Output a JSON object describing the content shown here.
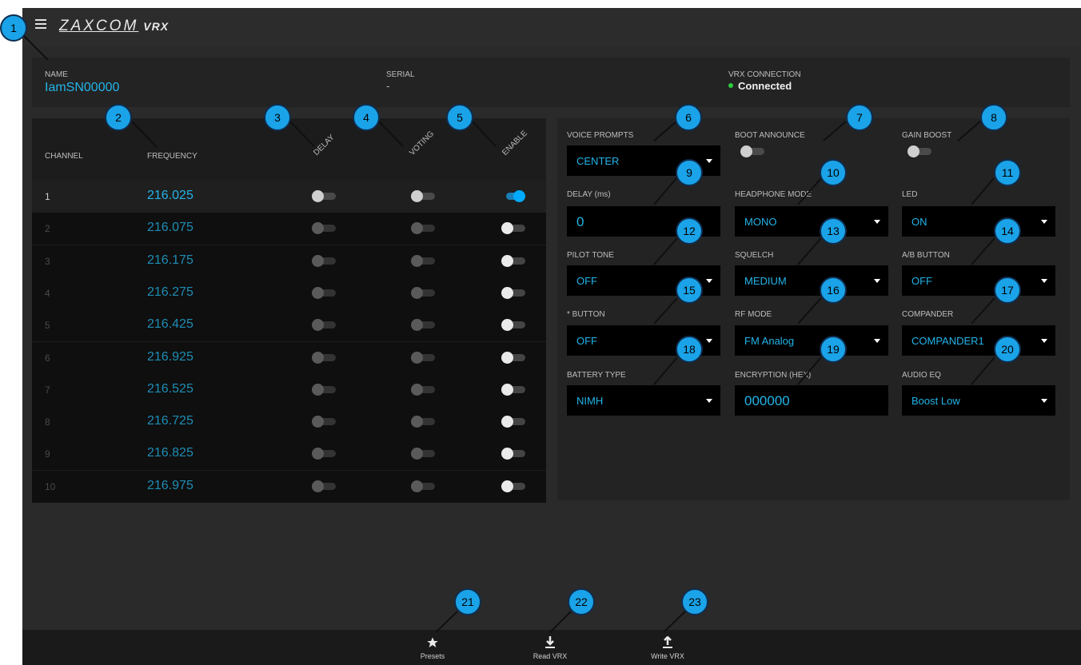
{
  "app": {
    "brand": "ZAXCOM",
    "model": "VRX"
  },
  "info": {
    "name_label": "NAME",
    "name_value": "IamSN00000",
    "serial_label": "SERIAL",
    "serial_value": "-",
    "connection_label": "VRX CONNECTION",
    "connection_value": "Connected",
    "connection_color": "#2ecc40"
  },
  "colors": {
    "accent": "#23b4e8",
    "accent_dim": "#1e8db4"
  },
  "channels": {
    "headers": {
      "channel": "CHANNEL",
      "frequency": "FREQUENCY",
      "delay": "DELAY",
      "voting": "VOTING",
      "enable": "ENABLE"
    },
    "rows": [
      {
        "channel": "1",
        "frequency": "216.025",
        "delay": false,
        "voting": false,
        "enable": true
      },
      {
        "channel": "2",
        "frequency": "216.075",
        "delay": false,
        "voting": false,
        "enable": false
      },
      {
        "channel": "3",
        "frequency": "216.175",
        "delay": false,
        "voting": false,
        "enable": false
      },
      {
        "channel": "4",
        "frequency": "216.275",
        "delay": false,
        "voting": false,
        "enable": false
      },
      {
        "channel": "5",
        "frequency": "216.425",
        "delay": false,
        "voting": false,
        "enable": false
      },
      {
        "channel": "6",
        "frequency": "216.925",
        "delay": false,
        "voting": false,
        "enable": false
      },
      {
        "channel": "7",
        "frequency": "216.525",
        "delay": false,
        "voting": false,
        "enable": false
      },
      {
        "channel": "8",
        "frequency": "216.725",
        "delay": false,
        "voting": false,
        "enable": false
      },
      {
        "channel": "9",
        "frequency": "216.825",
        "delay": false,
        "voting": false,
        "enable": false
      },
      {
        "channel": "10",
        "frequency": "216.975",
        "delay": false,
        "voting": false,
        "enable": false
      }
    ]
  },
  "settings": {
    "voice_prompts": {
      "label": "VOICE PROMPTS",
      "value": "CENTER"
    },
    "boot_announce": {
      "label": "BOOT ANNOUNCE",
      "value": false
    },
    "gain_boost": {
      "label": "GAIN BOOST",
      "value": false
    },
    "delay_ms": {
      "label": "DELAY (ms)",
      "value": "0"
    },
    "headphone_mode": {
      "label": "HEADPHONE MODE",
      "value": "MONO"
    },
    "led": {
      "label": "LED",
      "value": "ON"
    },
    "pilot_tone": {
      "label": "PILOT TONE",
      "value": "OFF"
    },
    "squelch": {
      "label": "SQUELCH",
      "value": "MEDIUM"
    },
    "ab_button": {
      "label": "A/B BUTTON",
      "value": "OFF"
    },
    "star_button": {
      "label": "* BUTTON",
      "value": "OFF"
    },
    "rf_mode": {
      "label": "RF MODE",
      "value": "FM Analog"
    },
    "compander": {
      "label": "COMPANDER",
      "value": "COMPANDER1"
    },
    "battery_type": {
      "label": "BATTERY TYPE",
      "value": "NIMH"
    },
    "encryption": {
      "label": "ENCRYPTION (HEX)",
      "value": "000000"
    },
    "audio_eq": {
      "label": "AUDIO EQ",
      "value": "Boost Low"
    }
  },
  "bottom": {
    "presets": {
      "label": "Presets",
      "icon": "star-icon"
    },
    "read": {
      "label": "Read VRX",
      "icon": "download-icon"
    },
    "write": {
      "label": "Write VRX",
      "icon": "upload-icon"
    }
  },
  "callouts": [
    "1",
    "2",
    "3",
    "4",
    "5",
    "6",
    "7",
    "8",
    "9",
    "10",
    "11",
    "12",
    "13",
    "14",
    "15",
    "16",
    "17",
    "18",
    "19",
    "20",
    "21",
    "22",
    "23"
  ],
  "callout_color": "#1aa3e8"
}
